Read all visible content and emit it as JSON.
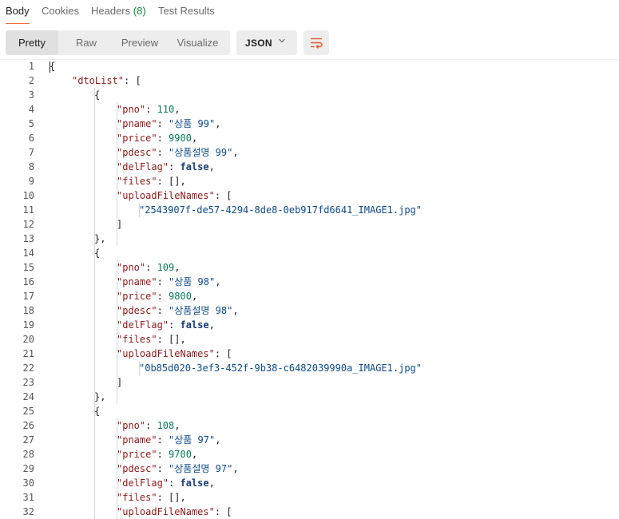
{
  "response_tabs": [
    {
      "label": "Body",
      "count": "",
      "active": true
    },
    {
      "label": "Cookies",
      "count": "",
      "active": false
    },
    {
      "label": "Headers",
      "count": "(8)",
      "active": false
    },
    {
      "label": "Test Results",
      "count": "",
      "active": false
    }
  ],
  "view_modes": [
    "Pretty",
    "Raw",
    "Preview",
    "Visualize"
  ],
  "active_view_mode": "Pretty",
  "format_select": {
    "value": "JSON"
  },
  "wrap_button": {
    "icon": "wrap-lines-icon"
  },
  "colors": {
    "active_tab_underline": "#f26b3a",
    "wrap_icon": "#e05a2b",
    "json_key": "#8b1a1a",
    "json_string": "#0d4a8a",
    "json_number": "#0a7a5a",
    "json_boolean": "#1a3c78"
  },
  "code_lines": [
    {
      "n": "1",
      "indent": 0,
      "tokens": [
        [
          "p",
          "{"
        ]
      ]
    },
    {
      "n": "2",
      "indent": 1,
      "tokens": [
        [
          "k",
          "\"dtoList\""
        ],
        [
          "p",
          ": ["
        ]
      ]
    },
    {
      "n": "3",
      "indent": 2,
      "tokens": [
        [
          "p",
          "{"
        ]
      ]
    },
    {
      "n": "4",
      "indent": 3,
      "tokens": [
        [
          "k",
          "\"pno\""
        ],
        [
          "p",
          ": "
        ],
        [
          "n",
          "110"
        ],
        [
          "p",
          ","
        ]
      ]
    },
    {
      "n": "5",
      "indent": 3,
      "tokens": [
        [
          "k",
          "\"pname\""
        ],
        [
          "p",
          ": "
        ],
        [
          "s",
          "\"상품 99\""
        ],
        [
          "p",
          ","
        ]
      ]
    },
    {
      "n": "6",
      "indent": 3,
      "tokens": [
        [
          "k",
          "\"price\""
        ],
        [
          "p",
          ": "
        ],
        [
          "n",
          "9900"
        ],
        [
          "p",
          ","
        ]
      ]
    },
    {
      "n": "7",
      "indent": 3,
      "tokens": [
        [
          "k",
          "\"pdesc\""
        ],
        [
          "p",
          ": "
        ],
        [
          "s",
          "\"상품설명 99\""
        ],
        [
          "p",
          ","
        ]
      ]
    },
    {
      "n": "8",
      "indent": 3,
      "tokens": [
        [
          "k",
          "\"delFlag\""
        ],
        [
          "p",
          ": "
        ],
        [
          "b",
          "false"
        ],
        [
          "p",
          ","
        ]
      ]
    },
    {
      "n": "9",
      "indent": 3,
      "tokens": [
        [
          "k",
          "\"files\""
        ],
        [
          "p",
          ": [],"
        ]
      ]
    },
    {
      "n": "10",
      "indent": 3,
      "tokens": [
        [
          "k",
          "\"uploadFileNames\""
        ],
        [
          "p",
          ": ["
        ]
      ]
    },
    {
      "n": "11",
      "indent": 4,
      "tokens": [
        [
          "s",
          "\"2543907f-de57-4294-8de8-0eb917fd6641_IMAGE1.jpg\""
        ]
      ]
    },
    {
      "n": "12",
      "indent": 3,
      "tokens": [
        [
          "p",
          "]"
        ]
      ]
    },
    {
      "n": "13",
      "indent": 2,
      "tokens": [
        [
          "p",
          "},"
        ]
      ]
    },
    {
      "n": "14",
      "indent": 2,
      "tokens": [
        [
          "p",
          "{"
        ]
      ]
    },
    {
      "n": "15",
      "indent": 3,
      "tokens": [
        [
          "k",
          "\"pno\""
        ],
        [
          "p",
          ": "
        ],
        [
          "n",
          "109"
        ],
        [
          "p",
          ","
        ]
      ]
    },
    {
      "n": "16",
      "indent": 3,
      "tokens": [
        [
          "k",
          "\"pname\""
        ],
        [
          "p",
          ": "
        ],
        [
          "s",
          "\"상품 98\""
        ],
        [
          "p",
          ","
        ]
      ]
    },
    {
      "n": "17",
      "indent": 3,
      "tokens": [
        [
          "k",
          "\"price\""
        ],
        [
          "p",
          ": "
        ],
        [
          "n",
          "9800"
        ],
        [
          "p",
          ","
        ]
      ]
    },
    {
      "n": "18",
      "indent": 3,
      "tokens": [
        [
          "k",
          "\"pdesc\""
        ],
        [
          "p",
          ": "
        ],
        [
          "s",
          "\"상품설명 98\""
        ],
        [
          "p",
          ","
        ]
      ]
    },
    {
      "n": "19",
      "indent": 3,
      "tokens": [
        [
          "k",
          "\"delFlag\""
        ],
        [
          "p",
          ": "
        ],
        [
          "b",
          "false"
        ],
        [
          "p",
          ","
        ]
      ]
    },
    {
      "n": "20",
      "indent": 3,
      "tokens": [
        [
          "k",
          "\"files\""
        ],
        [
          "p",
          ": [],"
        ]
      ]
    },
    {
      "n": "21",
      "indent": 3,
      "tokens": [
        [
          "k",
          "\"uploadFileNames\""
        ],
        [
          "p",
          ": ["
        ]
      ]
    },
    {
      "n": "22",
      "indent": 4,
      "tokens": [
        [
          "s",
          "\"0b85d020-3ef3-452f-9b38-c6482039990a_IMAGE1.jpg\""
        ]
      ]
    },
    {
      "n": "23",
      "indent": 3,
      "tokens": [
        [
          "p",
          "]"
        ]
      ]
    },
    {
      "n": "24",
      "indent": 2,
      "tokens": [
        [
          "p",
          "},"
        ]
      ]
    },
    {
      "n": "25",
      "indent": 2,
      "tokens": [
        [
          "p",
          "{"
        ]
      ]
    },
    {
      "n": "26",
      "indent": 3,
      "tokens": [
        [
          "k",
          "\"pno\""
        ],
        [
          "p",
          ": "
        ],
        [
          "n",
          "108"
        ],
        [
          "p",
          ","
        ]
      ]
    },
    {
      "n": "27",
      "indent": 3,
      "tokens": [
        [
          "k",
          "\"pname\""
        ],
        [
          "p",
          ": "
        ],
        [
          "s",
          "\"상품 97\""
        ],
        [
          "p",
          ","
        ]
      ]
    },
    {
      "n": "28",
      "indent": 3,
      "tokens": [
        [
          "k",
          "\"price\""
        ],
        [
          "p",
          ": "
        ],
        [
          "n",
          "9700"
        ],
        [
          "p",
          ","
        ]
      ]
    },
    {
      "n": "29",
      "indent": 3,
      "tokens": [
        [
          "k",
          "\"pdesc\""
        ],
        [
          "p",
          ": "
        ],
        [
          "s",
          "\"상품설명 97\""
        ],
        [
          "p",
          ","
        ]
      ]
    },
    {
      "n": "30",
      "indent": 3,
      "tokens": [
        [
          "k",
          "\"delFlag\""
        ],
        [
          "p",
          ": "
        ],
        [
          "b",
          "false"
        ],
        [
          "p",
          ","
        ]
      ]
    },
    {
      "n": "31",
      "indent": 3,
      "tokens": [
        [
          "k",
          "\"files\""
        ],
        [
          "p",
          ": [],"
        ]
      ]
    },
    {
      "n": "32",
      "indent": 3,
      "tokens": [
        [
          "k",
          "\"uploadFileNames\""
        ],
        [
          "p",
          ": ["
        ]
      ]
    }
  ]
}
